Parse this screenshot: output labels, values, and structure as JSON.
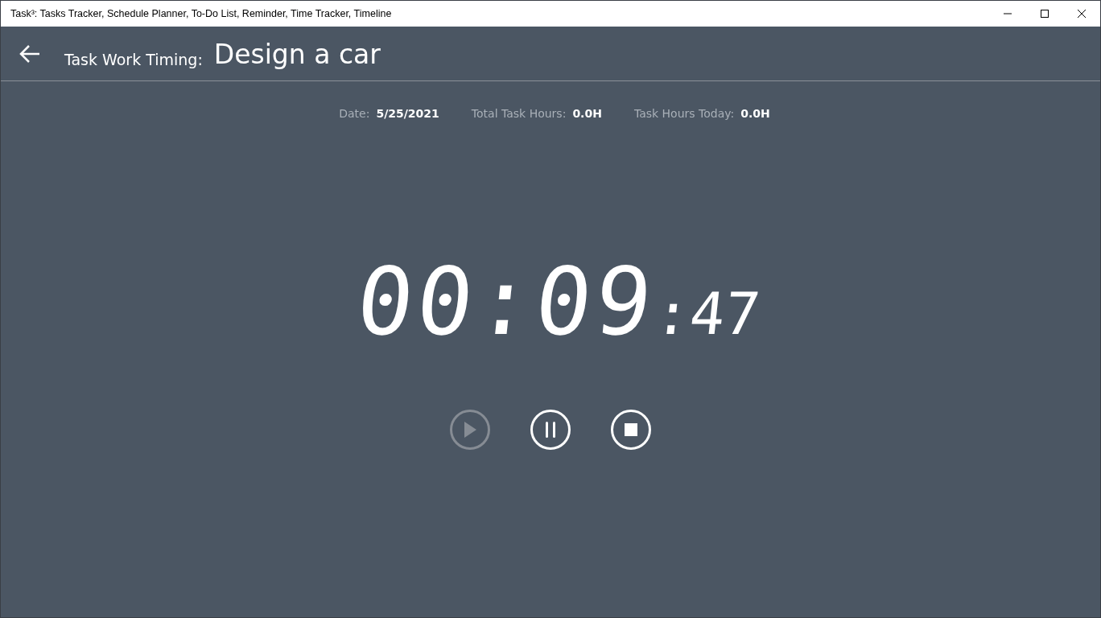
{
  "window": {
    "title": "Task³: Tasks Tracker, Schedule Planner, To-Do List, Reminder, Time Tracker, Timeline"
  },
  "header": {
    "label": "Task Work Timing:",
    "task_name": "Design a car"
  },
  "stats": [
    {
      "label": "Date:",
      "value": "5/25/2021"
    },
    {
      "label": "Total Task Hours:",
      "value": "0.0H"
    },
    {
      "label": "Task Hours Today:",
      "value": "0.0H"
    }
  ],
  "timer": {
    "hours_minutes": "00:09",
    "seconds": ":47"
  },
  "controls": [
    {
      "kind": "play",
      "disabled": true
    },
    {
      "kind": "pause",
      "disabled": false
    },
    {
      "kind": "stop",
      "disabled": false
    }
  ]
}
